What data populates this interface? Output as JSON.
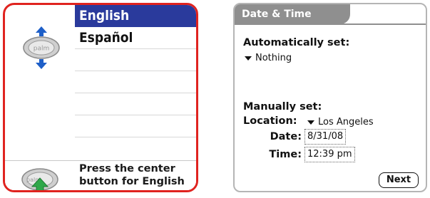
{
  "language_screen": {
    "languages": [
      "English",
      "Español"
    ],
    "selected_language": "English",
    "instruction_line1": "Press the center",
    "instruction_line2": "button for English",
    "palm_label": "palm",
    "icons": [
      "palm-button-icon",
      "up-arrow-icon",
      "down-arrow-icon"
    ],
    "colors": {
      "frame": "#e0231f",
      "selection": "#2a3a9c",
      "arrow_blue": "#1e5fc8",
      "arrow_green": "#2fa84a"
    }
  },
  "datetime_screen": {
    "title": "Date & Time",
    "auto_heading": "Automatically set:",
    "auto_value": "Nothing",
    "manual_heading": "Manually set:",
    "location_label": "Location:",
    "location_value": "Los Angeles",
    "date_label": "Date:",
    "date_value": "8/31/08",
    "time_label": "Time:",
    "time_value": "12:39 pm",
    "next_label": "Next"
  }
}
